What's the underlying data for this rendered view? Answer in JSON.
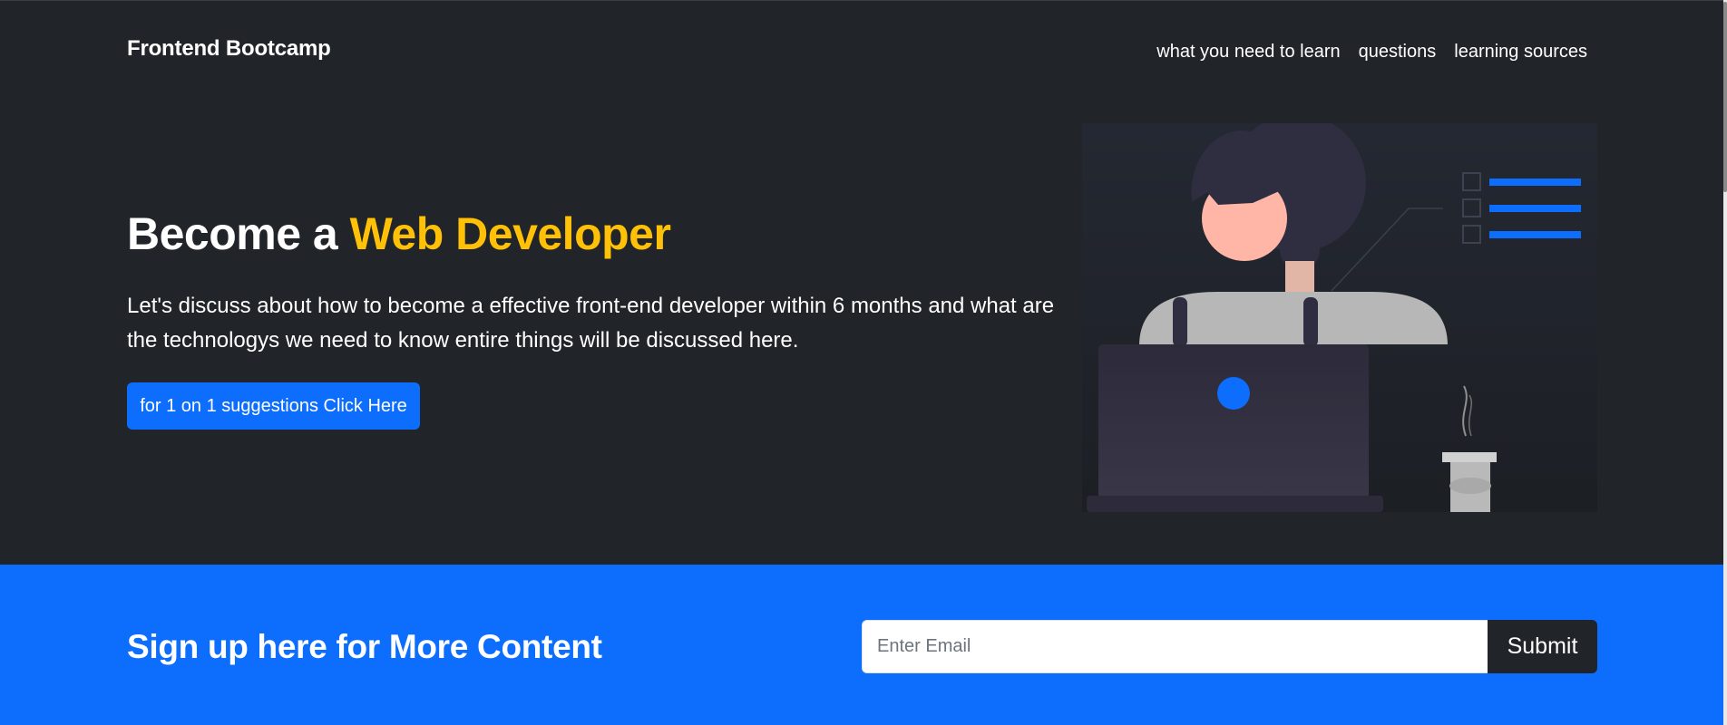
{
  "brand": "Frontend Bootcamp",
  "nav": {
    "items": [
      "what you need to learn",
      "questions",
      "learning sources"
    ]
  },
  "hero": {
    "headline_prefix": "Become a ",
    "headline_accent": "Web Developer",
    "lead": "Let's discuss about how to become a effective front-end developer within 6 months and what are the technologys we need to know entire things will be discussed here.",
    "cta_label": "for 1 on 1 suggestions Click Here"
  },
  "signup": {
    "title": "Sign up here for More Content",
    "email_placeholder": "Enter Email",
    "submit_label": "Submit"
  },
  "colors": {
    "dark_bg": "#212529",
    "accent_yellow": "#ffc107",
    "primary_blue": "#0d6efd"
  }
}
